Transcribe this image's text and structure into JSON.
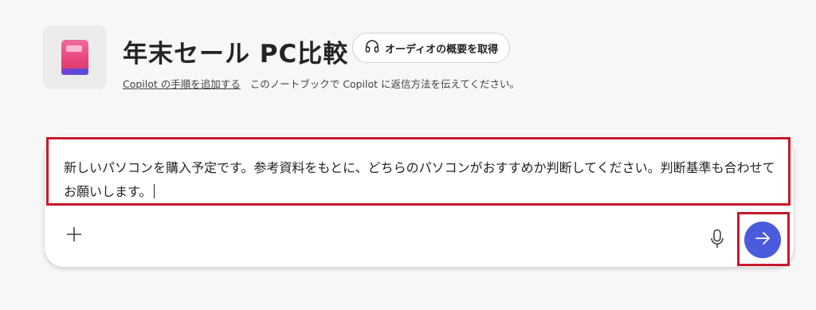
{
  "notebook": {
    "icon": "notebook-icon",
    "title": "年末セール PC比較",
    "audio_overview": {
      "icon": "headphones-icon",
      "label": "オーディオの概要を取得"
    },
    "copilot_instructions_link": "Copilot の手順を追加する",
    "copilot_instructions_hint": "このノートブックで Copilot に返信方法を伝えてください。"
  },
  "prompt": {
    "text": "新しいパソコンを購入予定です。参考資料をもとに、どちらのパソコンがおすすめか判断してください。判断基準も合わせてお願いします。",
    "add_icon": "plus-icon",
    "mic_icon": "microphone-icon",
    "send_icon": "arrow-right-icon"
  },
  "annotations": {
    "highlight_color": "#c8192c"
  },
  "colors": {
    "send_button": "#4a5bdc",
    "background": "#f7f7f7"
  }
}
